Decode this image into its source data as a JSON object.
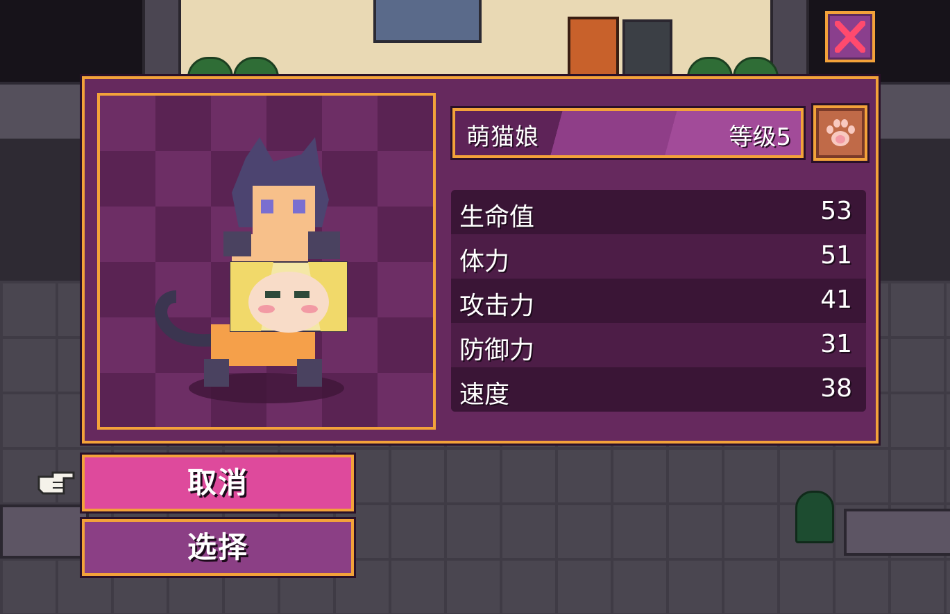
{
  "character": {
    "name": "萌猫娘",
    "level": "等级5"
  },
  "stats": [
    {
      "label": "生命值",
      "value": "53"
    },
    {
      "label": "体力",
      "value": "51"
    },
    {
      "label": "攻击力",
      "value": "41"
    },
    {
      "label": "防御力",
      "value": "31"
    },
    {
      "label": "速度",
      "value": "38"
    }
  ],
  "menu": {
    "cancel_label": "取消",
    "select_label": "选择"
  },
  "icons": {
    "close": "close-x-icon",
    "paw": "paw-icon",
    "pointer": "hand-pointer-icon"
  },
  "colors": {
    "accent": "#f3a23a",
    "panel": "#66295e",
    "cancel": "#de4a9c",
    "select": "#8b3f85",
    "close_x": "#ff4a6e"
  }
}
